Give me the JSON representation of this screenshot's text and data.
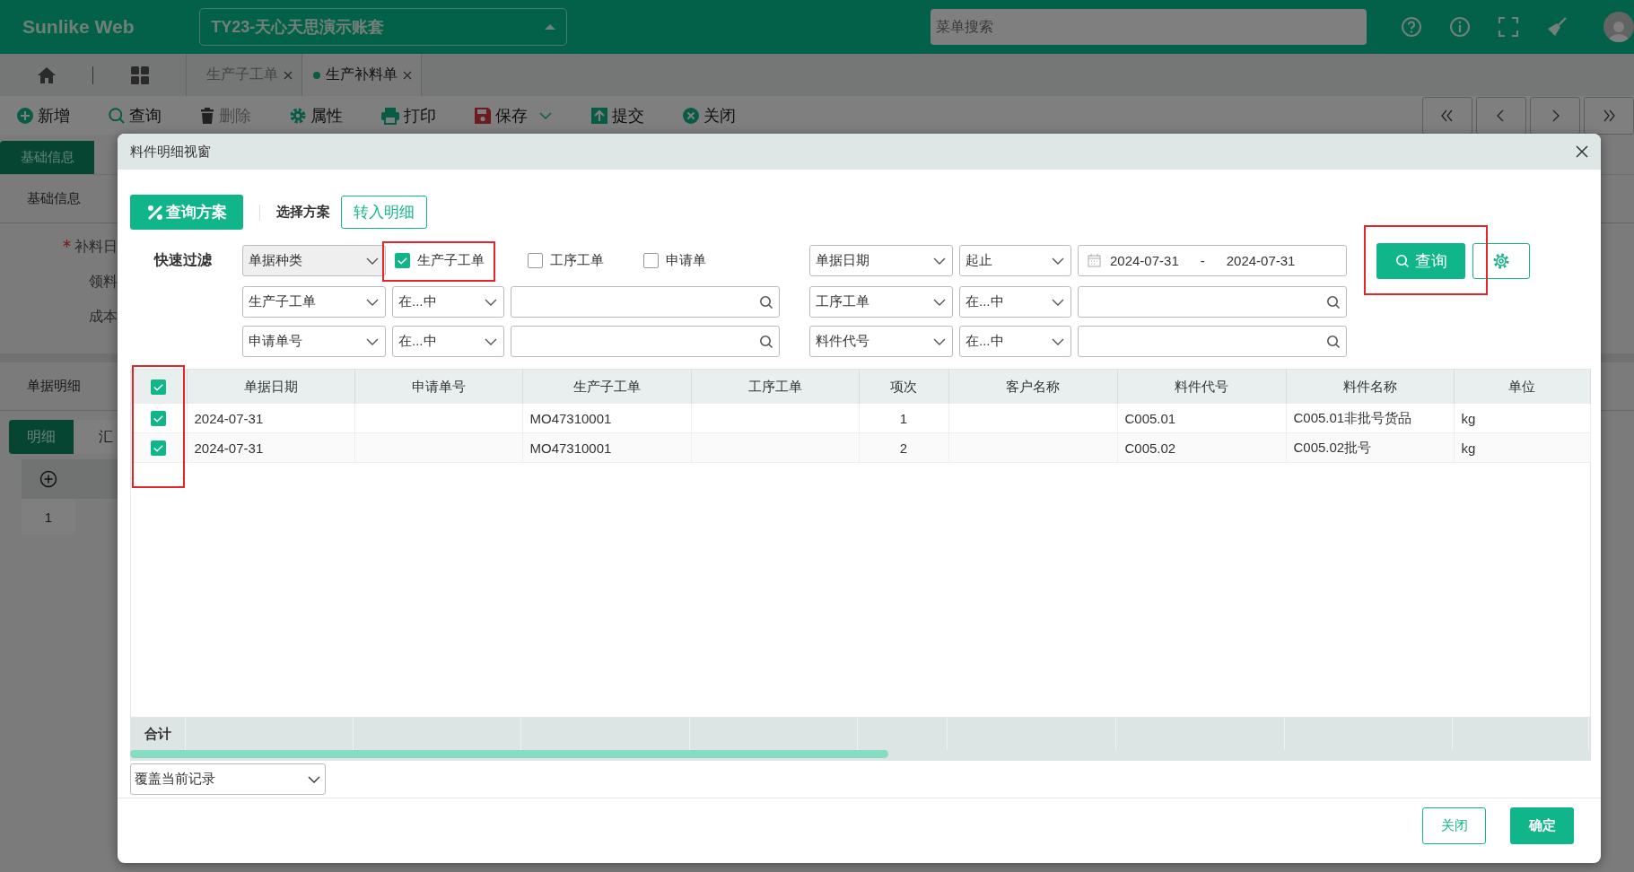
{
  "app": {
    "brand": "Sunlike Web",
    "account": "TY23-天心天思演示账套",
    "menu_search": {
      "placeholder": "菜单搜索"
    }
  },
  "page_tabs": [
    {
      "label": "生产子工单",
      "selected": false
    },
    {
      "label": "生产补料单",
      "selected": true
    }
  ],
  "toolbar": [
    {
      "label": "新增",
      "kind": "add",
      "disabled": false,
      "dropdown": false
    },
    {
      "label": "查询",
      "kind": "search",
      "disabled": false,
      "dropdown": false
    },
    {
      "label": "删除",
      "kind": "trash",
      "disabled": true,
      "dropdown": false
    },
    {
      "label": "属性",
      "kind": "gear",
      "disabled": false,
      "dropdown": false
    },
    {
      "label": "打印",
      "kind": "printer",
      "disabled": false,
      "dropdown": false
    },
    {
      "label": "保存",
      "kind": "save",
      "disabled": false,
      "dropdown": true
    },
    {
      "label": "提交",
      "kind": "submit",
      "disabled": false,
      "dropdown": false
    },
    {
      "label": "关闭",
      "kind": "close",
      "disabled": false,
      "dropdown": false
    }
  ],
  "form": {
    "tabs": [
      {
        "label": "基础信息",
        "selected": true
      }
    ],
    "section": "基础信息",
    "fields": [
      {
        "label": "补料日",
        "required": true
      },
      {
        "label": "领料",
        "required": false
      },
      {
        "label": "成本",
        "required": false
      }
    ]
  },
  "detail": {
    "section": "单据明细",
    "tabs": [
      {
        "label": "明细",
        "selected": true
      },
      {
        "label": "汇",
        "selected": false
      }
    ],
    "rows": [
      {
        "number": "1"
      }
    ]
  },
  "dialog": {
    "title": "料件明细视窗",
    "scheme_button": "查询方案",
    "scheme_label": "选择方案",
    "transfer_button": "转入明细",
    "filter_label": "快速过滤",
    "doc_type": {
      "value": "单据种类",
      "disabled": true
    },
    "doc_checks": [
      {
        "label": "生产子工单",
        "checked": true,
        "highlighted": true
      },
      {
        "label": "工序工单",
        "checked": false,
        "highlighted": false
      },
      {
        "label": "申请单",
        "checked": false,
        "highlighted": false
      }
    ],
    "date_filter": {
      "field": "单据日期",
      "operator": "起止",
      "from": "2024-07-31",
      "separator": "-",
      "to": "2024-07-31"
    },
    "conditions": [
      {
        "field": "生产子工单",
        "operator": "在...中"
      },
      {
        "field": "工序工单",
        "operator": "在...中"
      },
      {
        "field": "申请单号",
        "operator": "在...中"
      },
      {
        "field": "料件代号",
        "operator": "在...中"
      }
    ],
    "query_button": {
      "label": "查询",
      "highlighted": true
    },
    "table": {
      "all_checked": true,
      "checkbox_column_highlighted": true,
      "columns": [
        "单据日期",
        "申请单号",
        "生产子工单",
        "工序工单",
        "项次",
        "客户名称",
        "料件代号",
        "料件名称",
        "单位"
      ],
      "rows": [
        {
          "checked": true,
          "cells": [
            "2024-07-31",
            "",
            "MO47310001",
            "",
            "1",
            "",
            "C005.01",
            "C005.01非批号货品",
            "kg"
          ]
        },
        {
          "checked": true,
          "cells": [
            "2024-07-31",
            "",
            "MO47310001",
            "",
            "2",
            "",
            "C005.02",
            "C005.02批号",
            "kg"
          ]
        }
      ],
      "footer_label": "合计"
    },
    "mode_select": "覆盖当前记录",
    "buttons": [
      {
        "label": "关闭",
        "kind": "secondary"
      },
      {
        "label": "确定",
        "kind": "primary"
      }
    ]
  }
}
